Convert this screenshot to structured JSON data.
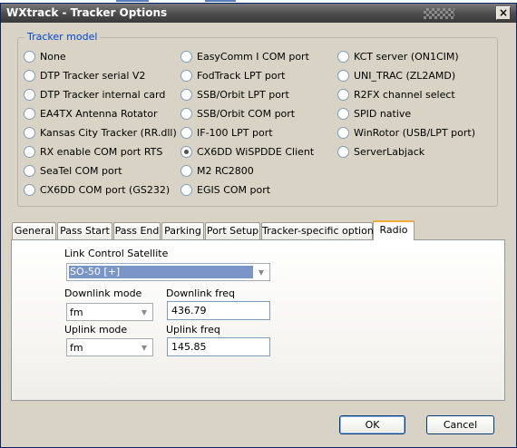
{
  "window": {
    "title": "WXtrack - Tracker Options",
    "close_glyph": "×"
  },
  "tracker_model": {
    "label": "Tracker model",
    "options": [
      "None",
      "DTP Tracker serial V2",
      "DTP Tracker internal card",
      "EA4TX Antenna Rotator",
      "Kansas City Tracker (RR.dll)",
      "RX enable COM port RTS",
      "SeaTel COM port",
      "CX6DD COM port (GS232)",
      "EasyComm I COM port",
      "FodTrack LPT port",
      "SSB/Orbit LPT port",
      "SSB/Orbit COM port",
      "IF-100 LPT port",
      "CX6DD WiSPDDE Client",
      "M2 RC2800",
      "EGIS COM port",
      "KCT server (ON1CIM)",
      "UNI_TRAC (ZL2AMD)",
      "R2FX channel select",
      "SPID native",
      "WinRotor (USB/LPT port)",
      "ServerLabjack"
    ],
    "selected": "CX6DD WiSPDDE Client"
  },
  "tabs": [
    "General",
    "Pass Start",
    "Pass End",
    "Parking",
    "Port Setup",
    "Tracker-specific options",
    "Radio"
  ],
  "active_tab": "Radio",
  "radio": {
    "link_control_label": "Link Control Satellite",
    "link_control_value": "SO-50 [+]",
    "downlink_mode_label": "Downlink mode",
    "downlink_mode_value": "fm",
    "downlink_freq_label": "Downlink freq",
    "downlink_freq_value": "436.79",
    "uplink_mode_label": "Uplink mode",
    "uplink_mode_value": "fm",
    "uplink_freq_label": "Uplink freq",
    "uplink_freq_value": "145.85"
  },
  "buttons": {
    "ok": "OK",
    "cancel": "Cancel"
  },
  "colors": {
    "group_label": "#0046d5",
    "active_tab_accent": "#f3a83b",
    "selection": "#7a96c8"
  }
}
